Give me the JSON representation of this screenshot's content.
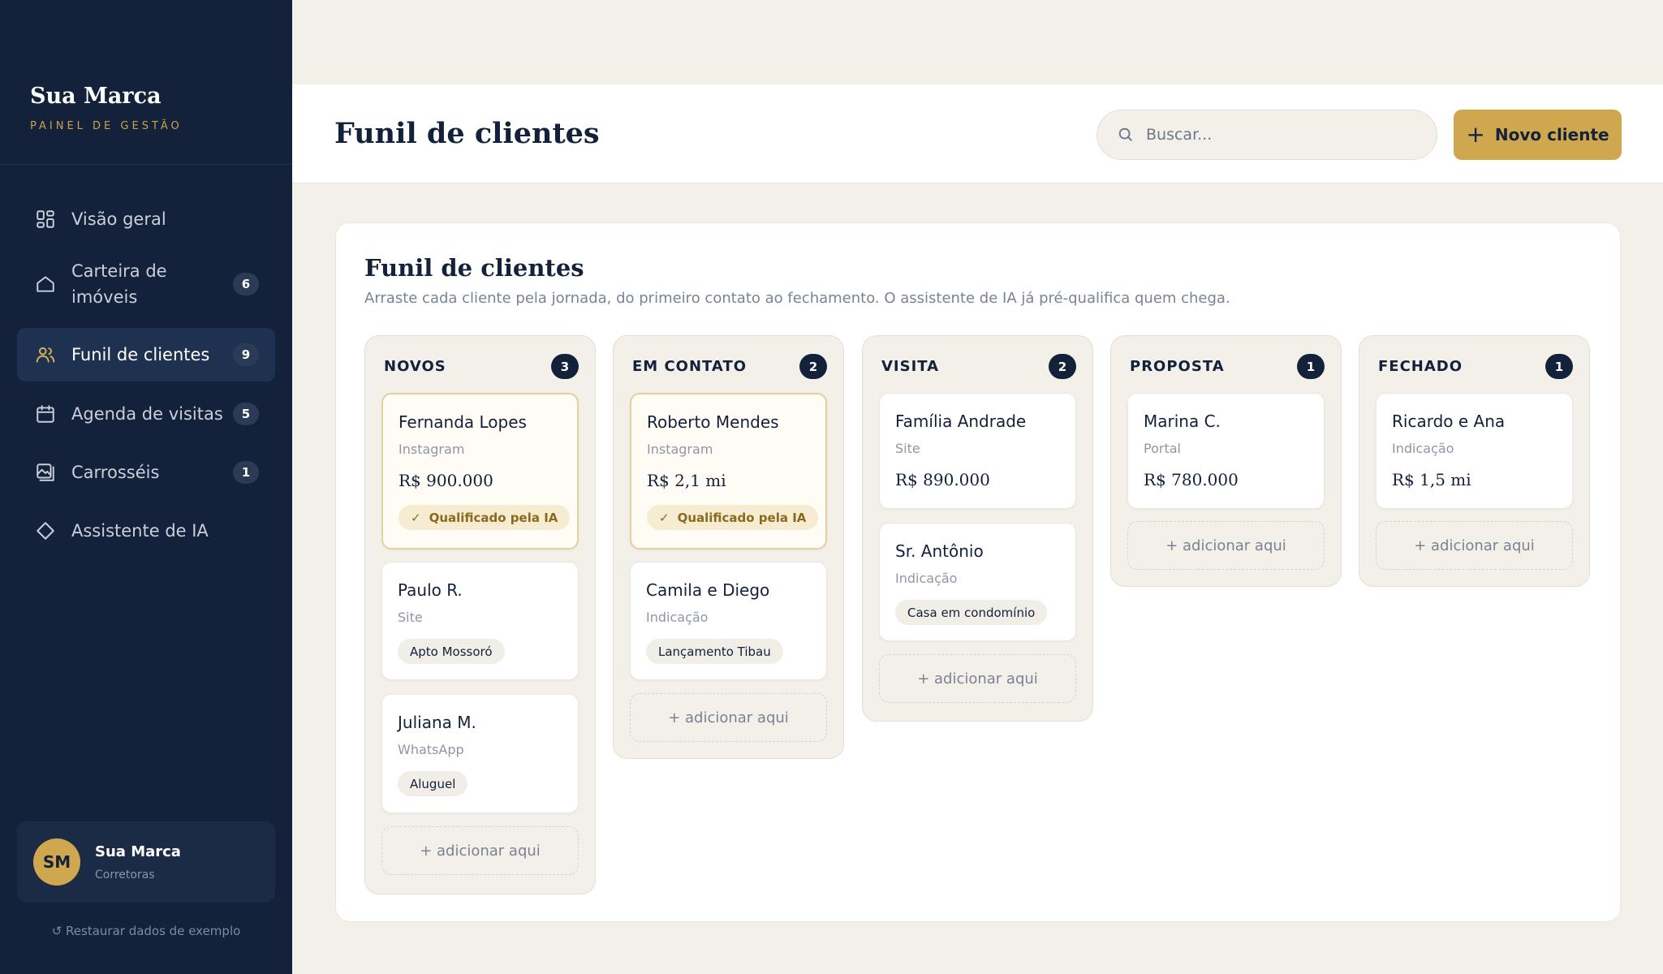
{
  "sidebar": {
    "brand_name": "Sua Marca",
    "brand_sub": "PAINEL DE GESTÃO",
    "items": [
      {
        "label": "Visão geral",
        "badge": ""
      },
      {
        "label": "Carteira de imóveis",
        "badge": "6"
      },
      {
        "label": "Funil de clientes",
        "badge": "9"
      },
      {
        "label": "Agenda de visitas",
        "badge": "5"
      },
      {
        "label": "Carrosséis",
        "badge": "1"
      },
      {
        "label": "Assistente de IA",
        "badge": ""
      }
    ],
    "user": {
      "initials": "SM",
      "name": "Sua Marca",
      "role": "Corretoras"
    },
    "restore": "↺ Restaurar dados de exemplo"
  },
  "header": {
    "title": "Funil de clientes",
    "search_placeholder": "Buscar...",
    "new_button": "Novo cliente"
  },
  "panel": {
    "title": "Funil de clientes",
    "subtitle": "Arraste cada cliente pela jornada, do primeiro contato ao fechamento. O assistente de IA já pré-qualifica quem chega.",
    "add_label": "+ adicionar aqui",
    "ai_label": "Qualificado pela IA",
    "columns": [
      {
        "title": "NOVOS",
        "count": "3",
        "cards": [
          {
            "name": "Fernanda Lopes",
            "source": "Instagram",
            "value": "R$ 900.000"
          },
          {
            "name": "Paulo R.",
            "source": "Site",
            "tag": "Apto Mossoró"
          },
          {
            "name": "Juliana M.",
            "source": "WhatsApp",
            "tag": "Aluguel"
          }
        ]
      },
      {
        "title": "EM CONTATO",
        "count": "2",
        "cards": [
          {
            "name": "Roberto Mendes",
            "source": "Instagram",
            "value": "R$ 2,1 mi"
          },
          {
            "name": "Camila e Diego",
            "source": "Indicação",
            "tag": "Lançamento Tibau"
          }
        ]
      },
      {
        "title": "VISITA",
        "count": "2",
        "cards": [
          {
            "name": "Família Andrade",
            "source": "Site",
            "value": "R$ 890.000"
          },
          {
            "name": "Sr. Antônio",
            "source": "Indicação",
            "tag": "Casa em condomínio"
          }
        ]
      },
      {
        "title": "PROPOSTA",
        "count": "1",
        "cards": [
          {
            "name": "Marina C.",
            "source": "Portal",
            "value": "R$ 780.000"
          }
        ]
      },
      {
        "title": "FECHADO",
        "count": "1",
        "cards": [
          {
            "name": "Ricardo e Ana",
            "source": "Indicação",
            "value": "R$ 1,5 mi"
          }
        ]
      }
    ]
  }
}
